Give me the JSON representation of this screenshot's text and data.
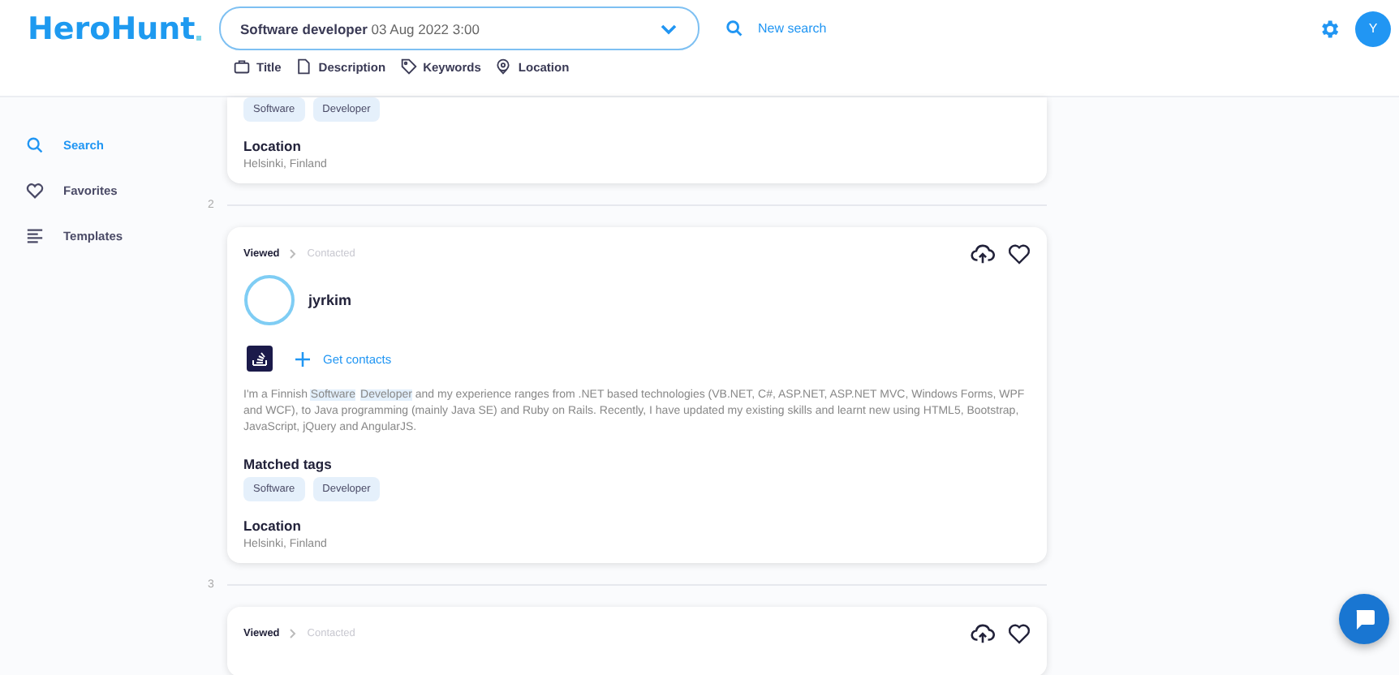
{
  "logo": {
    "text": "HeroHunt"
  },
  "search_select": {
    "query": "Software developer",
    "date": "03 Aug 2022 3:00"
  },
  "new_search": {
    "label": "New search"
  },
  "avatar": {
    "initial": "Y"
  },
  "filters": [
    {
      "label": "Title"
    },
    {
      "label": "Description"
    },
    {
      "label": "Keywords"
    },
    {
      "label": "Location"
    }
  ],
  "sidebar": {
    "items": [
      {
        "label": "Search",
        "selected": true
      },
      {
        "label": "Favorites",
        "selected": false
      },
      {
        "label": "Templates",
        "selected": false
      }
    ]
  },
  "results": [
    {
      "kind": "partial",
      "tags": [
        "Software",
        "Developer"
      ],
      "location_label": "Location",
      "location": "Helsinki, Finland"
    },
    {
      "kind": "full",
      "index": "2",
      "stages": [
        {
          "label": "Viewed",
          "reached": true
        },
        {
          "label": "Contacted",
          "reached": false
        }
      ],
      "name": "jyrkim",
      "get_contacts": "Get contacts",
      "description": [
        {
          "text": " I'm a Finnish ",
          "highlighted": false
        },
        {
          "text": "Software",
          "highlighted": true
        },
        {
          "text": "Developer",
          "highlighted": true
        },
        {
          "text": " and my experience ranges from .NET based technologies (VB.NET, C#, ASP.NET, ASP.NET MVC, Windows Forms, WPF and WCF), to Java programming (mainly Java SE) and Ruby on Rails.    Recently, I have updated my existing skills and learnt new using HTML5, Bootstrap, JavaScript, jQuery and AngularJS.",
          "highlighted": false
        }
      ],
      "tags_label": "Matched tags",
      "tags": [
        "Software",
        "Developer"
      ],
      "location_label": "Location",
      "location": "Helsinki, Finland"
    },
    {
      "kind": "header",
      "index": "3",
      "stages": [
        {
          "label": "Viewed",
          "reached": true
        },
        {
          "label": "Contacted",
          "reached": false
        }
      ]
    }
  ]
}
